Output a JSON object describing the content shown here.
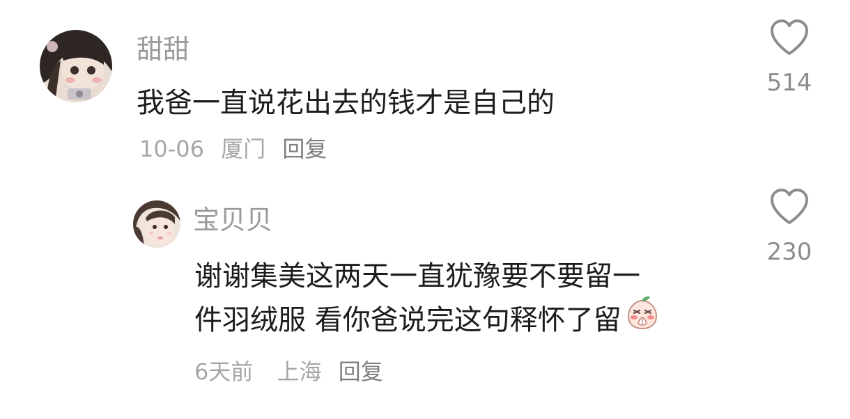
{
  "comments": [
    {
      "username": "甜甜",
      "text_lines": [
        "我爸一直说花出去的钱才是自己的"
      ],
      "date": "10-06",
      "location": "厦门",
      "reply_label": "回复",
      "likes": "514"
    },
    {
      "username": "宝贝贝",
      "text_lines": [
        "谢谢集美这两天一直犹豫要不要留一",
        "件羽绒服 看你爸说完这句释怀了留"
      ],
      "date": "6天前",
      "location": "上海",
      "reply_label": "回复",
      "likes": "230",
      "emoji": "peach-praying-emoji"
    }
  ],
  "colors": {
    "username": "#9a9a9a",
    "text": "#1c1c1c",
    "meta": "#a6a6a6",
    "reply": "#7d7d7d",
    "like_icon": "#8c8c8c"
  },
  "icons": {
    "like": "heart-outline-icon"
  }
}
